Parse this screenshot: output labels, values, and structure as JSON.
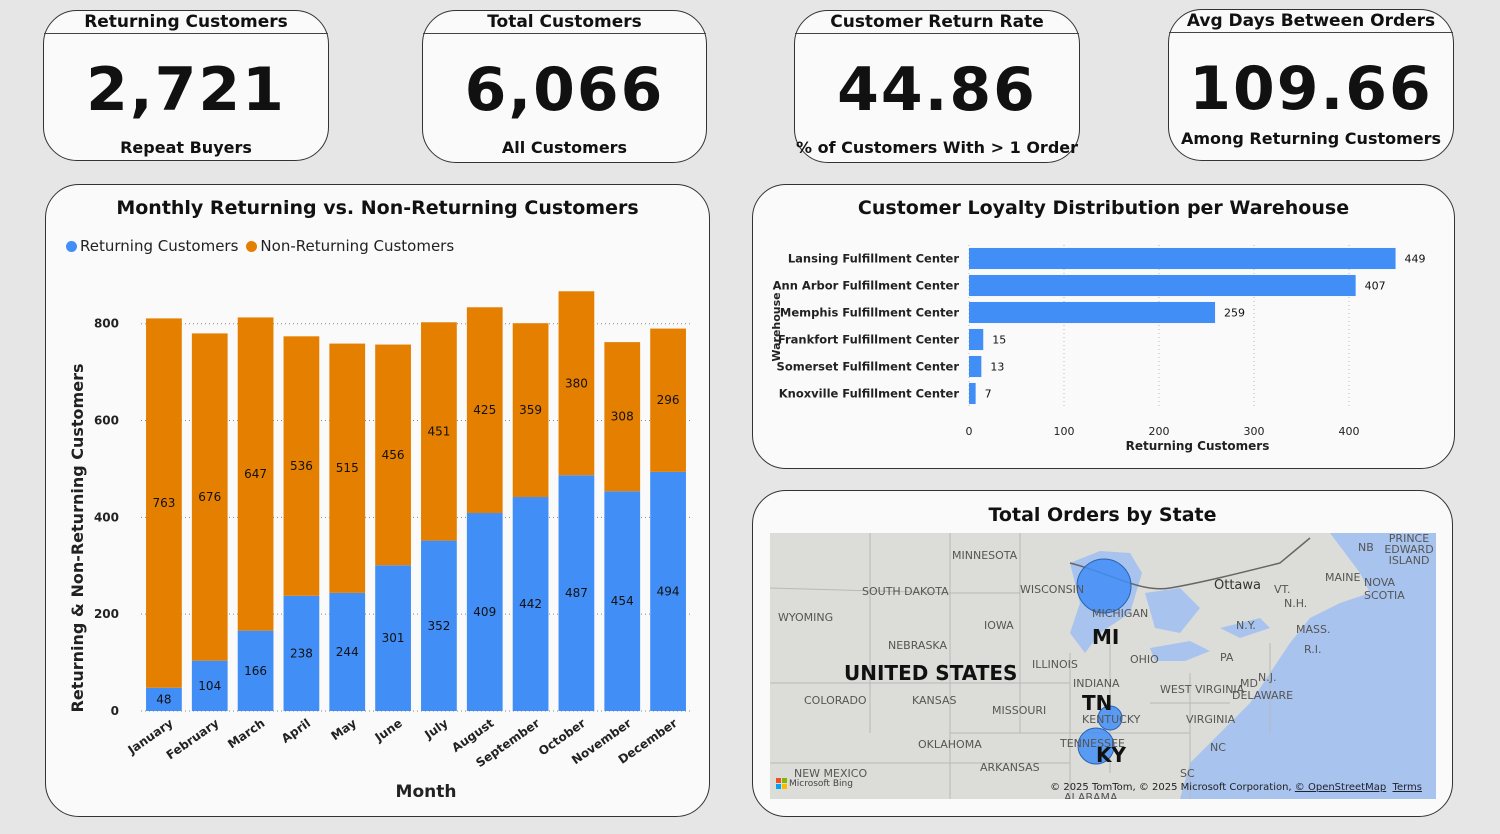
{
  "kpis": [
    {
      "title": "Returning Customers",
      "value": "2,721",
      "sub": "Repeat Buyers"
    },
    {
      "title": "Total Customers",
      "value": "6,066",
      "sub": "All Customers"
    },
    {
      "title": "Customer Return Rate",
      "value": "44.86",
      "sub": "% of Customers With > 1 Order"
    },
    {
      "title": "Avg Days Between Orders",
      "value": "109.66",
      "sub": "Among Returning Customers"
    }
  ],
  "colors": {
    "returning": "#428ef7",
    "non_returning": "#e57f00"
  },
  "chart_data": [
    {
      "type": "bar",
      "stacked": true,
      "title": "Monthly Returning vs. Non-Returning Customers",
      "xlabel": "Month",
      "ylabel": "Returning & Non-Returning Customers",
      "ylim": [
        0,
        880
      ],
      "yticks": [
        0,
        200,
        400,
        600,
        800
      ],
      "legend": "top-left",
      "categories": [
        "January",
        "February",
        "March",
        "April",
        "May",
        "June",
        "July",
        "August",
        "September",
        "October",
        "November",
        "December"
      ],
      "series": [
        {
          "name": "Returning Customers",
          "values": [
            48,
            104,
            166,
            238,
            244,
            301,
            352,
            409,
            442,
            487,
            454,
            494
          ]
        },
        {
          "name": "Non-Returning Customers",
          "values": [
            763,
            676,
            647,
            536,
            515,
            456,
            451,
            425,
            359,
            380,
            308,
            296
          ]
        }
      ]
    },
    {
      "type": "bar",
      "orientation": "horizontal",
      "title": "Customer Loyalty Distribution per Warehouse",
      "xlabel": "Returning Customers",
      "ylabel": "Warehouse",
      "xlim": [
        0,
        460
      ],
      "xticks": [
        0,
        100,
        200,
        300,
        400
      ],
      "categories": [
        "Lansing Fulfillment Center",
        "Ann Arbor Fulfillment Center",
        "Memphis Fulfillment Center",
        "Frankfort Fulfillment Center",
        "Somerset Fulfillment Center",
        "Knoxville Fulfillment Center"
      ],
      "values": [
        449,
        407,
        259,
        15,
        13,
        7
      ]
    }
  ],
  "map": {
    "title": "Total Orders by State",
    "states_big": [
      "MI",
      "TN",
      "KY"
    ],
    "country_label": "UNITED STATES",
    "labels": [
      "MINNESOTA",
      "SOUTH DAKOTA",
      "WYOMING",
      "WISCONSIN",
      "MICHIGAN",
      "IOWA",
      "NEBRASKA",
      "ILLINOIS",
      "OHIO",
      "INDIANA",
      "PA",
      "COLORADO",
      "KANSAS",
      "MISSOURI",
      "WEST VIRGINIA",
      "VIRGINIA",
      "KENTUCKY",
      "OKLAHOMA",
      "TENNESSEE",
      "NC",
      "ARKANSAS",
      "NEW MEXICO",
      "SC",
      "ALABAMA",
      "MD",
      "DELAWARE",
      "N.J.",
      "N.Y.",
      "MASS.",
      "R.I.",
      "VT.",
      "N.H.",
      "MAINE",
      "NB",
      "PRINCE EDWARD ISLAND",
      "NOVA SCOTIA",
      "Ottawa"
    ],
    "attribution": "© 2025 TomTom, © 2025 Microsoft Corporation,",
    "osm_link": "© OpenStreetMap",
    "terms_link": "Terms",
    "bing": "Microsoft Bing"
  }
}
